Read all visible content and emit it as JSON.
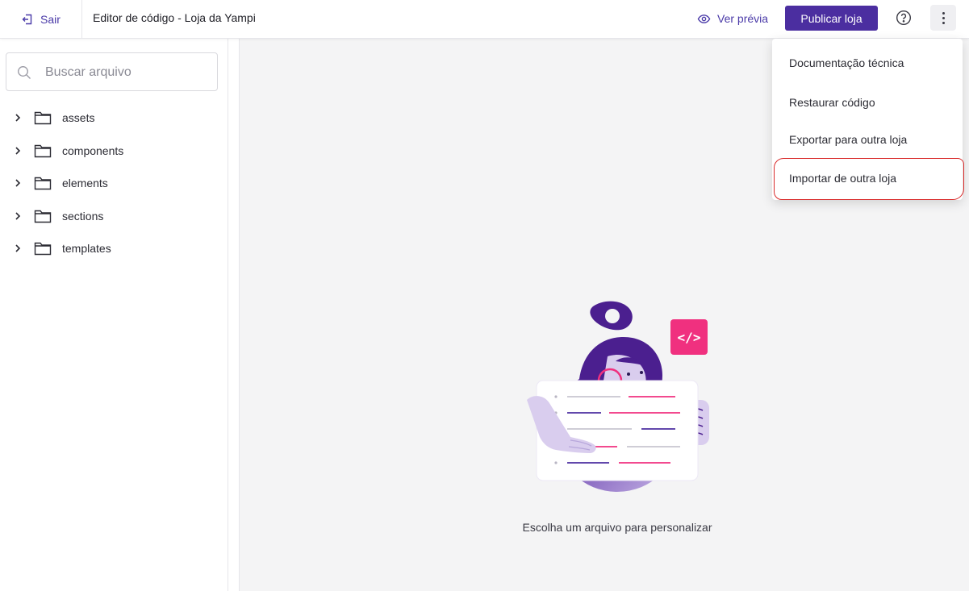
{
  "header": {
    "exit_label": "Sair",
    "title": "Editor de código - Loja da Yampi",
    "preview_label": "Ver prévia",
    "publish_label": "Publicar loja",
    "help_icon": "question-circle-icon",
    "more_icon": "vertical-dots-icon"
  },
  "sidebar": {
    "search": {
      "placeholder": "Buscar arquivo",
      "value": ""
    },
    "folders": [
      {
        "label": "assets"
      },
      {
        "label": "components"
      },
      {
        "label": "elements"
      },
      {
        "label": "sections"
      },
      {
        "label": "templates"
      }
    ]
  },
  "main": {
    "empty_state_text": "Escolha um arquivo para personalizar"
  },
  "menu": {
    "items": [
      {
        "label": "Documentação técnica"
      },
      {
        "label": "Restaurar código"
      },
      {
        "label": "Exportar para outra loja"
      },
      {
        "label": "Importar de outra loja"
      }
    ]
  },
  "colors": {
    "brand": "#4b2ea0",
    "accent_pink": "#f0307f",
    "highlight_ring": "#d92b2b",
    "illustration_purple": "#4b1f8f",
    "illustration_lilac": "#d9cdee"
  }
}
